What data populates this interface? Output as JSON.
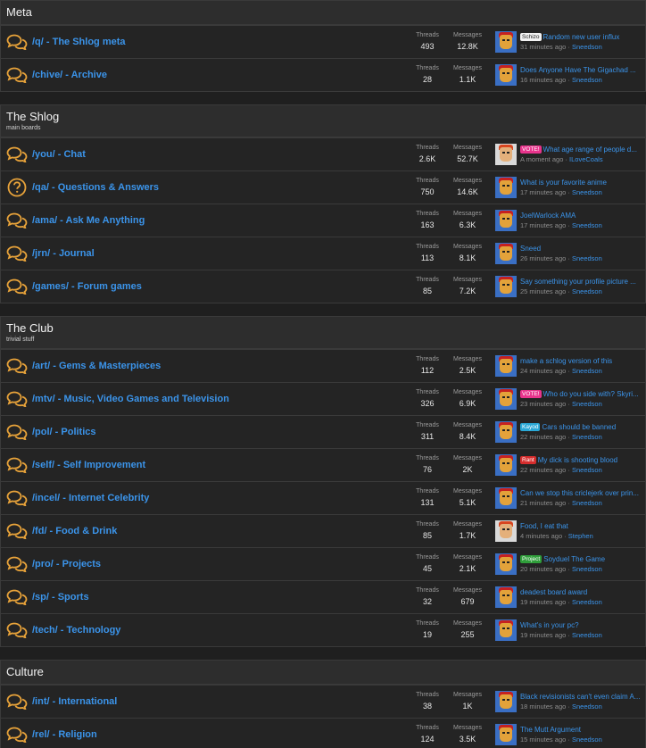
{
  "categories": [
    {
      "title": "Meta",
      "description": "",
      "nodes": [
        {
          "title": "/q/ - The Shlog meta",
          "icon": "chat-icon",
          "threads_label": "Threads",
          "threads": "493",
          "messages_label": "Messages",
          "messages": "12.8K",
          "latest": {
            "prefix": "Schizo",
            "prefix_color": "white",
            "title": "Random new user influx",
            "time": "31 minutes ago",
            "user": "Sneedson",
            "avatar": "default"
          }
        },
        {
          "title": "/chive/ - Archive",
          "icon": "chat-icon",
          "threads_label": "Threads",
          "threads": "28",
          "messages_label": "Messages",
          "messages": "1.1K",
          "latest": {
            "prefix": "",
            "prefix_color": "",
            "title": "Does Anyone Have The Gigachad ...",
            "time": "16 minutes ago",
            "user": "Sneedson",
            "avatar": "default"
          }
        }
      ]
    },
    {
      "title": "The Shlog",
      "description": "main boards",
      "nodes": [
        {
          "title": "/you/ - Chat",
          "icon": "chat-icon",
          "threads_label": "Threads",
          "threads": "2.6K",
          "messages_label": "Messages",
          "messages": "52.7K",
          "latest": {
            "prefix": "VOTE!",
            "prefix_color": "pink",
            "title": "What age range of people d...",
            "time": "A moment ago",
            "user": "ILoveCoals",
            "avatar": "alt"
          }
        },
        {
          "title": "/qa/ - Questions & Answers",
          "icon": "question-icon",
          "threads_label": "Threads",
          "threads": "750",
          "messages_label": "Messages",
          "messages": "14.6K",
          "latest": {
            "prefix": "",
            "prefix_color": "",
            "title": "What is your favorite anime",
            "time": "17 minutes ago",
            "user": "Sneedson",
            "avatar": "default"
          }
        },
        {
          "title": "/ama/ - Ask Me Anything",
          "icon": "chat-icon",
          "threads_label": "Threads",
          "threads": "163",
          "messages_label": "Messages",
          "messages": "6.3K",
          "latest": {
            "prefix": "",
            "prefix_color": "",
            "title": "JoelWarlock AMA",
            "time": "17 minutes ago",
            "user": "Sneedson",
            "avatar": "default"
          }
        },
        {
          "title": "/jrn/ - Journal",
          "icon": "chat-icon",
          "threads_label": "Threads",
          "threads": "113",
          "messages_label": "Messages",
          "messages": "8.1K",
          "latest": {
            "prefix": "",
            "prefix_color": "",
            "title": "Sneed",
            "time": "26 minutes ago",
            "user": "Sneedson",
            "avatar": "default"
          }
        },
        {
          "title": "/games/ - Forum games",
          "icon": "chat-icon",
          "threads_label": "Threads",
          "threads": "85",
          "messages_label": "Messages",
          "messages": "7.2K",
          "latest": {
            "prefix": "",
            "prefix_color": "",
            "title": "Say something your profile picture ...",
            "time": "25 minutes ago",
            "user": "Sneedson",
            "avatar": "default"
          }
        }
      ]
    },
    {
      "title": "The Club",
      "description": "trivial stuff",
      "nodes": [
        {
          "title": "/art/ - Gems & Masterpieces",
          "icon": "chat-icon",
          "threads_label": "Threads",
          "threads": "112",
          "messages_label": "Messages",
          "messages": "2.5K",
          "latest": {
            "prefix": "",
            "prefix_color": "",
            "title": "make a schlog version of this",
            "time": "24 minutes ago",
            "user": "Sneedson",
            "avatar": "default"
          }
        },
        {
          "title": "/mtv/ - Music, Video Games and Television",
          "icon": "chat-icon",
          "threads_label": "Threads",
          "threads": "326",
          "messages_label": "Messages",
          "messages": "6.9K",
          "latest": {
            "prefix": "VOTE!",
            "prefix_color": "pink",
            "title": "Who do you side with? Skyri...",
            "time": "23 minutes ago",
            "user": "Sneedson",
            "avatar": "default"
          }
        },
        {
          "title": "/pol/ - Politics",
          "icon": "chat-icon",
          "threads_label": "Threads",
          "threads": "311",
          "messages_label": "Messages",
          "messages": "8.4K",
          "latest": {
            "prefix": "Kayod",
            "prefix_color": "cyan",
            "title": "Cars should be banned",
            "time": "22 minutes ago",
            "user": "Sneedson",
            "avatar": "default"
          }
        },
        {
          "title": "/self/ - Self Improvement",
          "icon": "chat-icon",
          "threads_label": "Threads",
          "threads": "76",
          "messages_label": "Messages",
          "messages": "2K",
          "latest": {
            "prefix": "Rant",
            "prefix_color": "red",
            "title": "My dick is shooting blood",
            "time": "22 minutes ago",
            "user": "Sneedson",
            "avatar": "default"
          }
        },
        {
          "title": "/incel/ - Internet Celebrity",
          "icon": "chat-icon",
          "threads_label": "Threads",
          "threads": "131",
          "messages_label": "Messages",
          "messages": "5.1K",
          "latest": {
            "prefix": "",
            "prefix_color": "",
            "title": "Can we stop this criclejerk over prin...",
            "time": "21 minutes ago",
            "user": "Sneedson",
            "avatar": "default"
          }
        },
        {
          "title": "/fd/ - Food & Drink",
          "icon": "chat-icon",
          "threads_label": "Threads",
          "threads": "85",
          "messages_label": "Messages",
          "messages": "1.7K",
          "latest": {
            "prefix": "",
            "prefix_color": "",
            "title": "Food, I eat that",
            "time": "4 minutes ago",
            "user": "Stephen",
            "avatar": "alt"
          }
        },
        {
          "title": "/pro/ - Projects",
          "icon": "chat-icon",
          "threads_label": "Threads",
          "threads": "45",
          "messages_label": "Messages",
          "messages": "2.1K",
          "latest": {
            "prefix": "Project",
            "prefix_color": "green",
            "title": "Soyduel The Game",
            "time": "20 minutes ago",
            "user": "Sneedson",
            "avatar": "default"
          }
        },
        {
          "title": "/sp/ - Sports",
          "icon": "chat-icon",
          "threads_label": "Threads",
          "threads": "32",
          "messages_label": "Messages",
          "messages": "679",
          "latest": {
            "prefix": "",
            "prefix_color": "",
            "title": "deadest board award",
            "time": "19 minutes ago",
            "user": "Sneedson",
            "avatar": "default"
          }
        },
        {
          "title": "/tech/ - Technology",
          "icon": "chat-icon",
          "threads_label": "Threads",
          "threads": "19",
          "messages_label": "Messages",
          "messages": "255",
          "latest": {
            "prefix": "",
            "prefix_color": "",
            "title": "What's in your pc?",
            "time": "19 minutes ago",
            "user": "Sneedson",
            "avatar": "default"
          }
        }
      ]
    },
    {
      "title": "Culture",
      "description": "",
      "nodes": [
        {
          "title": "/int/ - International",
          "icon": "chat-icon",
          "threads_label": "Threads",
          "threads": "38",
          "messages_label": "Messages",
          "messages": "1K",
          "latest": {
            "prefix": "",
            "prefix_color": "",
            "title": "Black revisionists can't even claim A...",
            "time": "18 minutes ago",
            "user": "Sneedson",
            "avatar": "default"
          }
        },
        {
          "title": "/rel/ - Religion",
          "icon": "chat-icon",
          "threads_label": "Threads",
          "threads": "124",
          "messages_label": "Messages",
          "messages": "3.5K",
          "latest": {
            "prefix": "",
            "prefix_color": "",
            "title": "The Mutt Argument",
            "time": "15 minutes ago",
            "user": "Sneedson",
            "avatar": "default"
          }
        }
      ]
    }
  ],
  "latest_separator": " · ",
  "colors": {
    "link": "#3b94ea",
    "icon": "#e8a33a",
    "background": "#1f1f1f"
  }
}
